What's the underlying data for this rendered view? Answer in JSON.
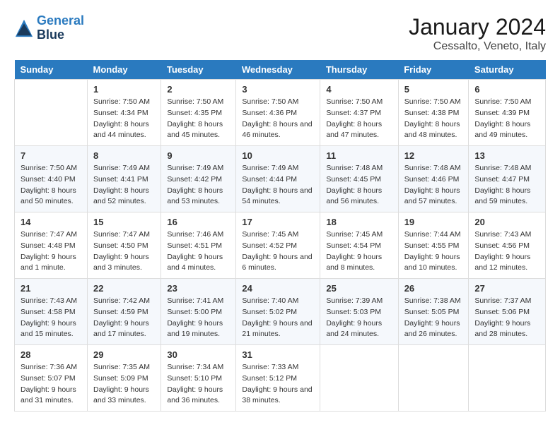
{
  "header": {
    "logo_line1": "General",
    "logo_line2": "Blue",
    "title": "January 2024",
    "subtitle": "Cessalto, Veneto, Italy"
  },
  "days_header": [
    "Sunday",
    "Monday",
    "Tuesday",
    "Wednesday",
    "Thursday",
    "Friday",
    "Saturday"
  ],
  "weeks": [
    [
      {
        "num": "",
        "sunrise": "",
        "sunset": "",
        "daylight": ""
      },
      {
        "num": "1",
        "sunrise": "Sunrise: 7:50 AM",
        "sunset": "Sunset: 4:34 PM",
        "daylight": "Daylight: 8 hours and 44 minutes."
      },
      {
        "num": "2",
        "sunrise": "Sunrise: 7:50 AM",
        "sunset": "Sunset: 4:35 PM",
        "daylight": "Daylight: 8 hours and 45 minutes."
      },
      {
        "num": "3",
        "sunrise": "Sunrise: 7:50 AM",
        "sunset": "Sunset: 4:36 PM",
        "daylight": "Daylight: 8 hours and 46 minutes."
      },
      {
        "num": "4",
        "sunrise": "Sunrise: 7:50 AM",
        "sunset": "Sunset: 4:37 PM",
        "daylight": "Daylight: 8 hours and 47 minutes."
      },
      {
        "num": "5",
        "sunrise": "Sunrise: 7:50 AM",
        "sunset": "Sunset: 4:38 PM",
        "daylight": "Daylight: 8 hours and 48 minutes."
      },
      {
        "num": "6",
        "sunrise": "Sunrise: 7:50 AM",
        "sunset": "Sunset: 4:39 PM",
        "daylight": "Daylight: 8 hours and 49 minutes."
      }
    ],
    [
      {
        "num": "7",
        "sunrise": "Sunrise: 7:50 AM",
        "sunset": "Sunset: 4:40 PM",
        "daylight": "Daylight: 8 hours and 50 minutes."
      },
      {
        "num": "8",
        "sunrise": "Sunrise: 7:49 AM",
        "sunset": "Sunset: 4:41 PM",
        "daylight": "Daylight: 8 hours and 52 minutes."
      },
      {
        "num": "9",
        "sunrise": "Sunrise: 7:49 AM",
        "sunset": "Sunset: 4:42 PM",
        "daylight": "Daylight: 8 hours and 53 minutes."
      },
      {
        "num": "10",
        "sunrise": "Sunrise: 7:49 AM",
        "sunset": "Sunset: 4:44 PM",
        "daylight": "Daylight: 8 hours and 54 minutes."
      },
      {
        "num": "11",
        "sunrise": "Sunrise: 7:48 AM",
        "sunset": "Sunset: 4:45 PM",
        "daylight": "Daylight: 8 hours and 56 minutes."
      },
      {
        "num": "12",
        "sunrise": "Sunrise: 7:48 AM",
        "sunset": "Sunset: 4:46 PM",
        "daylight": "Daylight: 8 hours and 57 minutes."
      },
      {
        "num": "13",
        "sunrise": "Sunrise: 7:48 AM",
        "sunset": "Sunset: 4:47 PM",
        "daylight": "Daylight: 8 hours and 59 minutes."
      }
    ],
    [
      {
        "num": "14",
        "sunrise": "Sunrise: 7:47 AM",
        "sunset": "Sunset: 4:48 PM",
        "daylight": "Daylight: 9 hours and 1 minute."
      },
      {
        "num": "15",
        "sunrise": "Sunrise: 7:47 AM",
        "sunset": "Sunset: 4:50 PM",
        "daylight": "Daylight: 9 hours and 3 minutes."
      },
      {
        "num": "16",
        "sunrise": "Sunrise: 7:46 AM",
        "sunset": "Sunset: 4:51 PM",
        "daylight": "Daylight: 9 hours and 4 minutes."
      },
      {
        "num": "17",
        "sunrise": "Sunrise: 7:45 AM",
        "sunset": "Sunset: 4:52 PM",
        "daylight": "Daylight: 9 hours and 6 minutes."
      },
      {
        "num": "18",
        "sunrise": "Sunrise: 7:45 AM",
        "sunset": "Sunset: 4:54 PM",
        "daylight": "Daylight: 9 hours and 8 minutes."
      },
      {
        "num": "19",
        "sunrise": "Sunrise: 7:44 AM",
        "sunset": "Sunset: 4:55 PM",
        "daylight": "Daylight: 9 hours and 10 minutes."
      },
      {
        "num": "20",
        "sunrise": "Sunrise: 7:43 AM",
        "sunset": "Sunset: 4:56 PM",
        "daylight": "Daylight: 9 hours and 12 minutes."
      }
    ],
    [
      {
        "num": "21",
        "sunrise": "Sunrise: 7:43 AM",
        "sunset": "Sunset: 4:58 PM",
        "daylight": "Daylight: 9 hours and 15 minutes."
      },
      {
        "num": "22",
        "sunrise": "Sunrise: 7:42 AM",
        "sunset": "Sunset: 4:59 PM",
        "daylight": "Daylight: 9 hours and 17 minutes."
      },
      {
        "num": "23",
        "sunrise": "Sunrise: 7:41 AM",
        "sunset": "Sunset: 5:00 PM",
        "daylight": "Daylight: 9 hours and 19 minutes."
      },
      {
        "num": "24",
        "sunrise": "Sunrise: 7:40 AM",
        "sunset": "Sunset: 5:02 PM",
        "daylight": "Daylight: 9 hours and 21 minutes."
      },
      {
        "num": "25",
        "sunrise": "Sunrise: 7:39 AM",
        "sunset": "Sunset: 5:03 PM",
        "daylight": "Daylight: 9 hours and 24 minutes."
      },
      {
        "num": "26",
        "sunrise": "Sunrise: 7:38 AM",
        "sunset": "Sunset: 5:05 PM",
        "daylight": "Daylight: 9 hours and 26 minutes."
      },
      {
        "num": "27",
        "sunrise": "Sunrise: 7:37 AM",
        "sunset": "Sunset: 5:06 PM",
        "daylight": "Daylight: 9 hours and 28 minutes."
      }
    ],
    [
      {
        "num": "28",
        "sunrise": "Sunrise: 7:36 AM",
        "sunset": "Sunset: 5:07 PM",
        "daylight": "Daylight: 9 hours and 31 minutes."
      },
      {
        "num": "29",
        "sunrise": "Sunrise: 7:35 AM",
        "sunset": "Sunset: 5:09 PM",
        "daylight": "Daylight: 9 hours and 33 minutes."
      },
      {
        "num": "30",
        "sunrise": "Sunrise: 7:34 AM",
        "sunset": "Sunset: 5:10 PM",
        "daylight": "Daylight: 9 hours and 36 minutes."
      },
      {
        "num": "31",
        "sunrise": "Sunrise: 7:33 AM",
        "sunset": "Sunset: 5:12 PM",
        "daylight": "Daylight: 9 hours and 38 minutes."
      },
      {
        "num": "",
        "sunrise": "",
        "sunset": "",
        "daylight": ""
      },
      {
        "num": "",
        "sunrise": "",
        "sunset": "",
        "daylight": ""
      },
      {
        "num": "",
        "sunrise": "",
        "sunset": "",
        "daylight": ""
      }
    ]
  ]
}
